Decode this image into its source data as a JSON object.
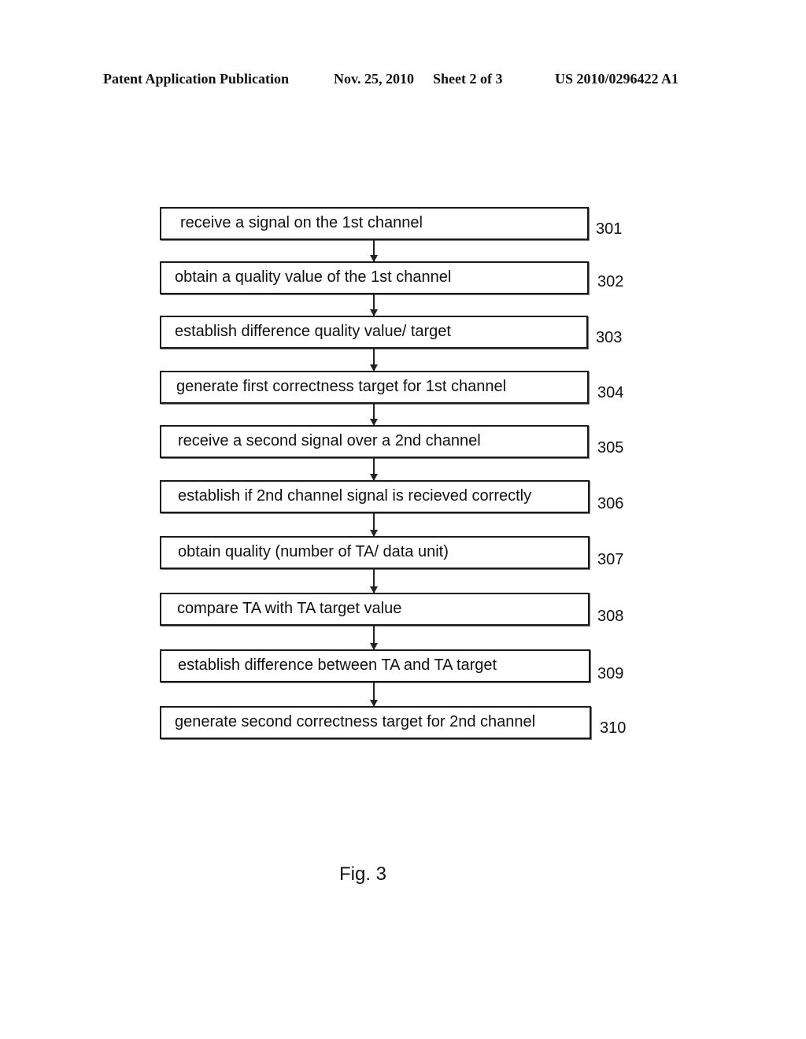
{
  "header": {
    "publication": "Patent Application Publication",
    "date": "Nov. 25, 2010",
    "sheet": "Sheet 2 of 3",
    "number": "US 2010/0296422 A1"
  },
  "steps": [
    {
      "text": "receive a signal on the 1st channel",
      "ref": "301"
    },
    {
      "text": "obtain a quality value of the 1st channel",
      "ref": "302"
    },
    {
      "text": "establish difference quality value/ target",
      "ref": "303"
    },
    {
      "text": "generate first correctness target for 1st channel",
      "ref": "304"
    },
    {
      "text": "receive a second signal over a 2nd channel",
      "ref": "305"
    },
    {
      "text": "establish if 2nd channel signal is recieved correctly",
      "ref": "306"
    },
    {
      "text": "obtain quality (number of TA/ data unit)",
      "ref": "307"
    },
    {
      "text": "compare TA with TA target value",
      "ref": "308"
    },
    {
      "text": "establish difference between TA and TA target",
      "ref": "309"
    },
    {
      "text": "generate second correctness target for 2nd channel",
      "ref": "310"
    }
  ],
  "figure_label": "Fig. 3"
}
